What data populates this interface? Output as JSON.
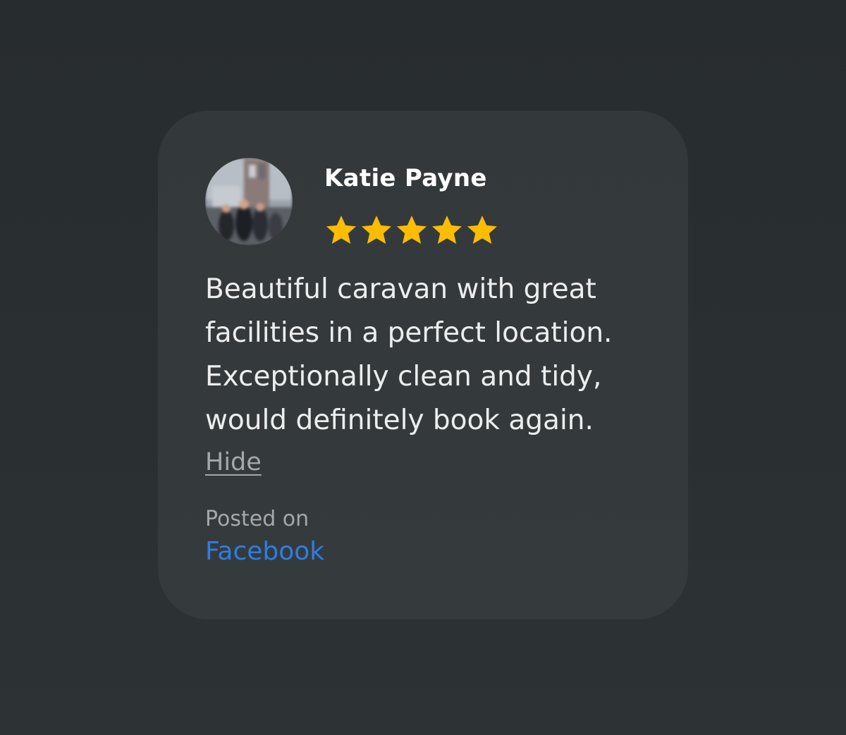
{
  "review": {
    "author_name": "Katie Payne",
    "rating": 5,
    "max_rating": 5,
    "star_color": "#fbbc04",
    "text": "Beautiful caravan with great facilities in a perfect location. Exceptionally clean and tidy, would definitely book again.",
    "hide_label": "Hide",
    "posted_on_label": "Posted on",
    "platform": "Facebook",
    "platform_color": "#2f7de0"
  },
  "icons": {
    "avatar": "user-photo-avatar",
    "star": "star-icon"
  }
}
